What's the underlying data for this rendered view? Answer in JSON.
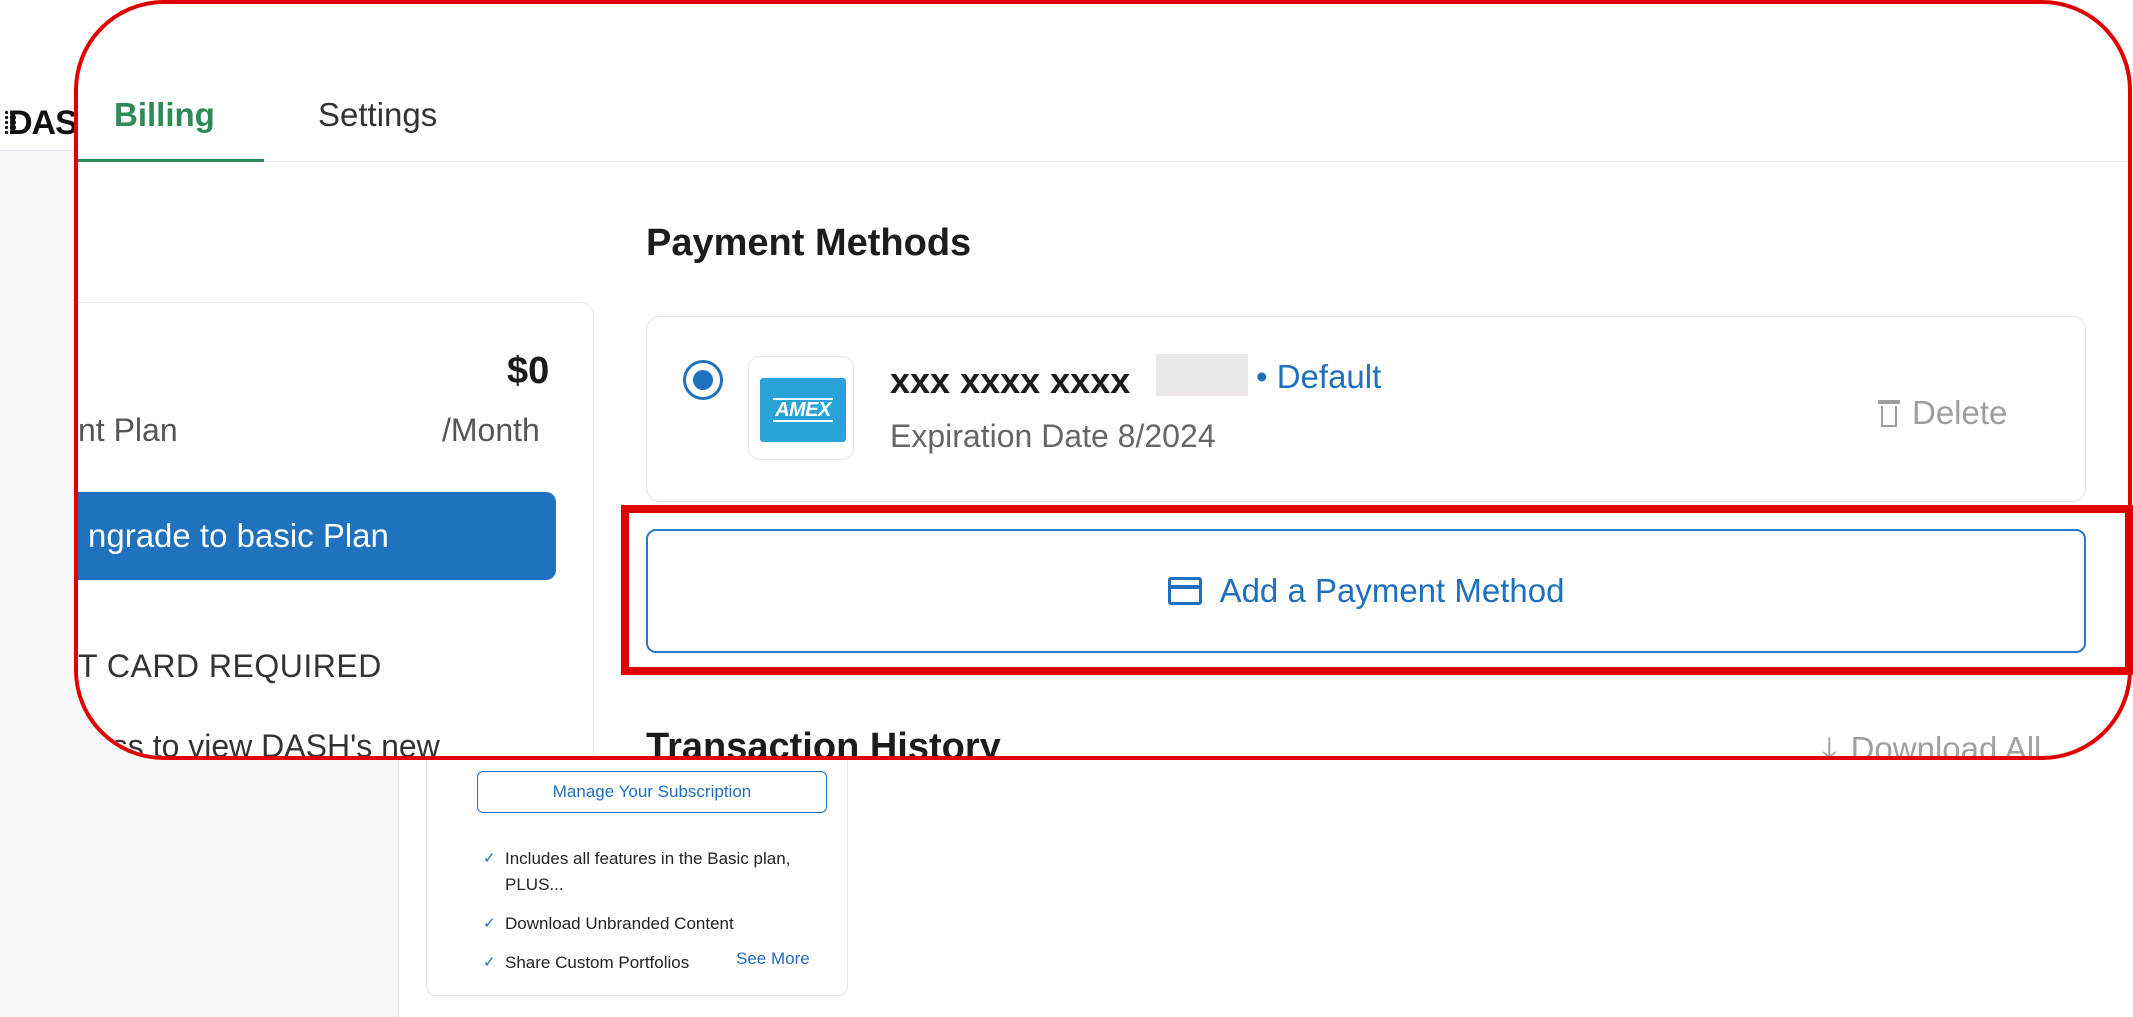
{
  "brand": {
    "logo_text": "DASH"
  },
  "tabs": [
    {
      "label": "Billing",
      "active": true
    },
    {
      "label": "Settings",
      "active": false
    }
  ],
  "plan": {
    "price": "$0",
    "name": "nt Plan",
    "period": "/Month",
    "upgrade_label": "ngrade to basic Plan",
    "credit_note": "T CARD REQUIRED",
    "access_text": "cess to view DASH's new"
  },
  "payment_methods": {
    "title": "Payment Methods",
    "card": {
      "number": "xxx xxxx xxxx",
      "brand": "AMEX",
      "default_label": "• Default",
      "expiration": "Expiration Date 8/2024",
      "delete_label": "Delete"
    },
    "add_label": "Add a Payment Method"
  },
  "transactions": {
    "title": "Transaction History",
    "download_label": "Download All"
  },
  "subscription_card": {
    "manage_label": "Manage Your Subscription",
    "features": [
      "Includes all features in the Basic plan, PLUS...",
      "Download Unbranded Content",
      "Share Custom Portfolios"
    ],
    "see_more": "See More"
  },
  "colors": {
    "accent_green": "#2e8b57",
    "primary_blue": "#1f72bd",
    "highlight_red": "#e00000",
    "amex_blue": "#2aa4d8"
  }
}
